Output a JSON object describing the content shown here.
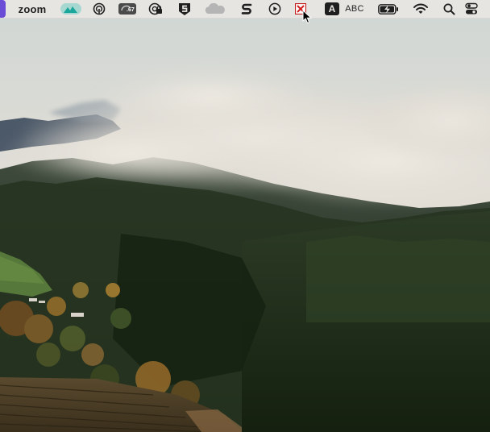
{
  "menubar": {
    "app_name": "zoom",
    "items": [
      {
        "icon": "zoom-mountain-icon"
      },
      {
        "icon": "airdrop-headphones-icon"
      },
      {
        "icon": "istat-gauge-icon",
        "value": ".67"
      },
      {
        "icon": "vpn-lock-icon"
      },
      {
        "icon": "shield-s-icon"
      },
      {
        "icon": "cloud-icon"
      },
      {
        "icon": "scrivener-s-icon"
      },
      {
        "icon": "play-circle-icon"
      },
      {
        "icon": "blocked-app-icon"
      },
      {
        "icon": "input-source-a-icon",
        "value": "A"
      },
      {
        "icon": "spellcheck-abc-icon",
        "value": "ABC"
      },
      {
        "icon": "battery-charging-icon"
      },
      {
        "icon": "wifi-icon"
      },
      {
        "icon": "spotlight-search-icon"
      },
      {
        "icon": "control-center-icon"
      }
    ]
  },
  "colors": {
    "menubar_bg": "#e8e6e2",
    "zoom_teal": "#2fc1b4",
    "mouse_cursor": "#000000"
  },
  "wallpaper": {
    "icon": "foggy-forest-hills-wallpaper"
  }
}
